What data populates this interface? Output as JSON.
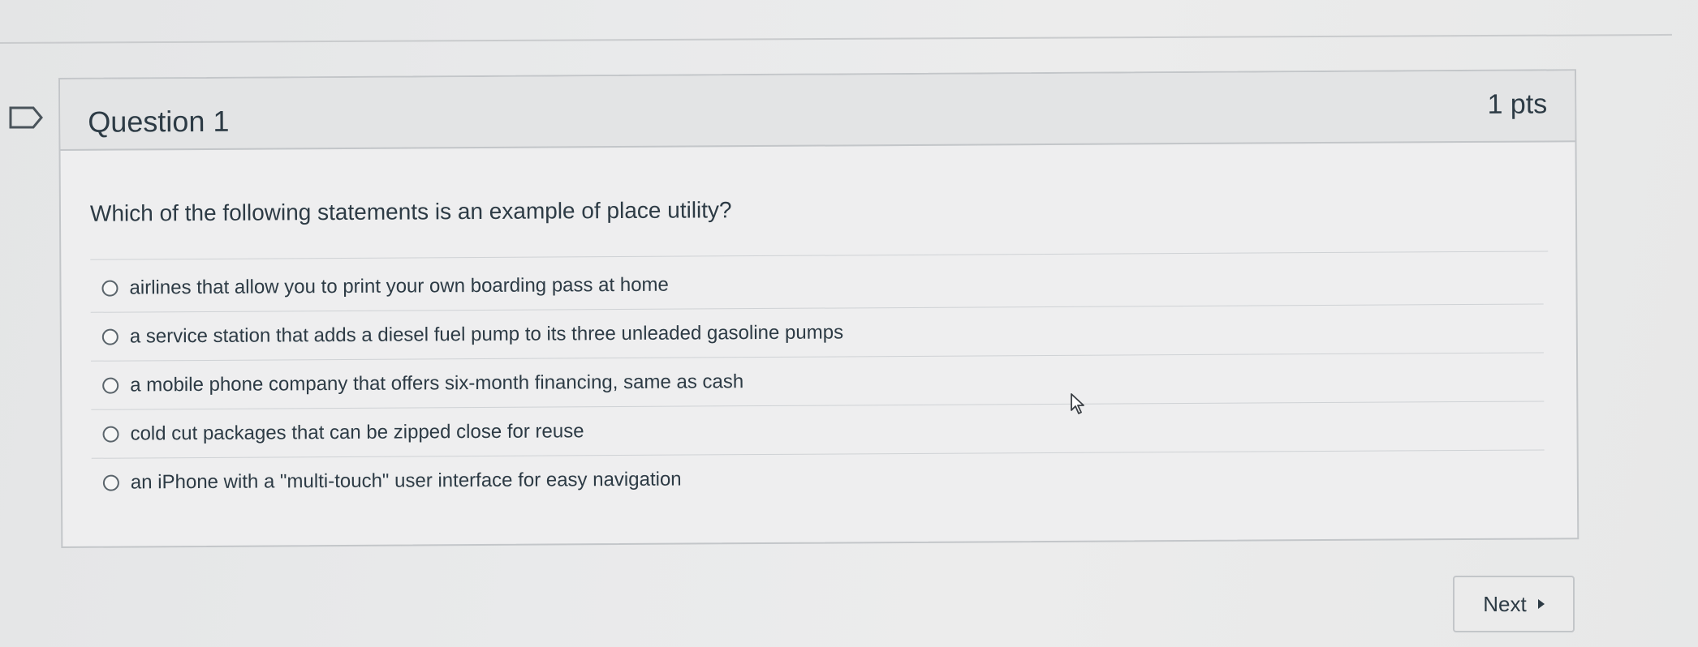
{
  "question": {
    "title": "Question 1",
    "points": "1 pts",
    "text": "Which of the following statements is an example of place utility?",
    "answers": [
      {
        "label": "airlines that allow you to print your own boarding pass at home"
      },
      {
        "label": "a service station that adds a diesel fuel pump to its three unleaded gasoline pumps"
      },
      {
        "label": "a mobile phone company that offers six-month financing, same as cash"
      },
      {
        "label": "cold cut packages that can be zipped close for reuse"
      },
      {
        "label": "an iPhone with a \"multi-touch\" user interface for easy navigation"
      }
    ],
    "selected_answer": null
  },
  "navigation": {
    "next_label": "Next"
  },
  "icons": {
    "flag": "flag-question-icon",
    "radio": "radio-unselected-icon",
    "cursor": "mouse-pointer-icon",
    "next": "caret-right-icon"
  },
  "colors": {
    "text": "#2d3b45",
    "border": "#c3c6c9",
    "header_background": "#e3e4e5",
    "card_background": "#eeeeef"
  }
}
